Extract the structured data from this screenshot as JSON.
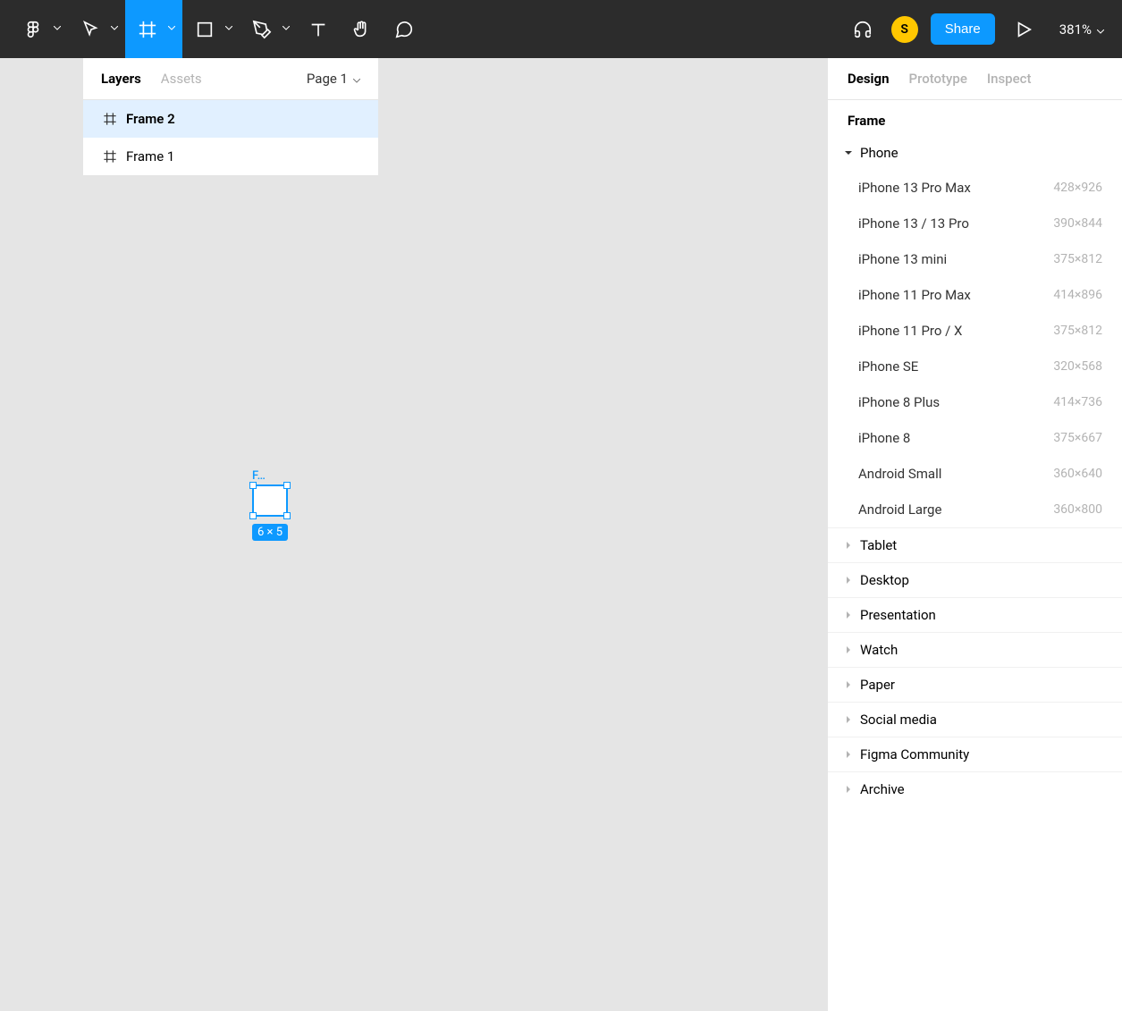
{
  "toolbar": {
    "avatar_letter": "S",
    "share_label": "Share",
    "zoom": "381%"
  },
  "left_panel": {
    "tabs": {
      "layers": "Layers",
      "assets": "Assets"
    },
    "page_label": "Page 1",
    "layers": [
      {
        "name": "Frame 2",
        "selected": true
      },
      {
        "name": "Frame 1",
        "selected": false
      }
    ]
  },
  "canvas": {
    "frame_label": "F…",
    "dim_label": "6 × 5"
  },
  "right_panel": {
    "tabs": {
      "design": "Design",
      "prototype": "Prototype",
      "inspect": "Inspect"
    },
    "section_title": "Frame",
    "groups": [
      {
        "name": "Phone",
        "expanded": true,
        "presets": [
          {
            "name": "iPhone 13 Pro Max",
            "dim": "428×926"
          },
          {
            "name": "iPhone 13 / 13 Pro",
            "dim": "390×844"
          },
          {
            "name": "iPhone 13 mini",
            "dim": "375×812"
          },
          {
            "name": "iPhone 11 Pro Max",
            "dim": "414×896"
          },
          {
            "name": "iPhone 11 Pro / X",
            "dim": "375×812"
          },
          {
            "name": "iPhone SE",
            "dim": "320×568"
          },
          {
            "name": "iPhone 8 Plus",
            "dim": "414×736"
          },
          {
            "name": "iPhone 8",
            "dim": "375×667"
          },
          {
            "name": "Android Small",
            "dim": "360×640"
          },
          {
            "name": "Android Large",
            "dim": "360×800"
          }
        ]
      },
      {
        "name": "Tablet",
        "expanded": false,
        "presets": []
      },
      {
        "name": "Desktop",
        "expanded": false,
        "presets": []
      },
      {
        "name": "Presentation",
        "expanded": false,
        "presets": []
      },
      {
        "name": "Watch",
        "expanded": false,
        "presets": []
      },
      {
        "name": "Paper",
        "expanded": false,
        "presets": []
      },
      {
        "name": "Social media",
        "expanded": false,
        "presets": []
      },
      {
        "name": "Figma Community",
        "expanded": false,
        "presets": []
      },
      {
        "name": "Archive",
        "expanded": false,
        "presets": []
      }
    ]
  }
}
